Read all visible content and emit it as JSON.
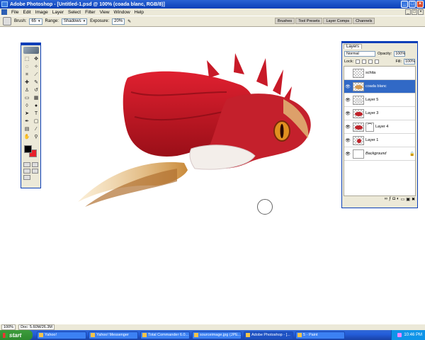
{
  "window": {
    "title": "Adobe Photoshop - [Untitled-1.psd @ 100% (coada blanc, RGB/8)]",
    "controls": [
      "_",
      "□",
      "×"
    ]
  },
  "menu": {
    "items": [
      "File",
      "Edit",
      "Image",
      "Layer",
      "Select",
      "Filter",
      "View",
      "Window",
      "Help"
    ]
  },
  "options": {
    "brush_label": "Brush:",
    "brush_size": "65",
    "range_label": "Range:",
    "range_value": "Shadows",
    "exposure_label": "Exposure:",
    "exposure_value": "20%"
  },
  "palette_well": {
    "tabs": [
      "Brushes",
      "Tool Presets",
      "Layer Comps",
      "Channels"
    ]
  },
  "layers_panel": {
    "tab": "Layers",
    "blend_mode": "Normal",
    "opacity_label": "Opacity:",
    "opacity_value": "100%",
    "lock_label": "Lock:",
    "fill_label": "Fill:",
    "fill_value": "100%",
    "layers": [
      {
        "name": "schita",
        "visible": false,
        "active": false
      },
      {
        "name": "coada blanc",
        "visible": true,
        "active": true
      },
      {
        "name": "Layer 5",
        "visible": true,
        "active": false
      },
      {
        "name": "Layer 3",
        "visible": true,
        "active": false
      },
      {
        "name": "Layer 4",
        "visible": true,
        "active": false
      },
      {
        "name": "Layer 1",
        "visible": true,
        "active": false
      },
      {
        "name": "Background",
        "visible": true,
        "active": false
      }
    ]
  },
  "status": {
    "zoom": "100%",
    "doc_info": "Doc: 5.60M/26.3M"
  },
  "taskbar": {
    "start_label": "start",
    "buttons": [
      "Yahoo!",
      "Yahoo! Messenger",
      "Total Commander 6.0...",
      "sourceimage.jpg (JPE...",
      "Adobe Photoshop - [...",
      "5 - Paint"
    ],
    "clock": "10:46 PM"
  },
  "colors": {
    "foreground": "#000000",
    "background": "#e8202a",
    "selection": "#3169c6"
  }
}
